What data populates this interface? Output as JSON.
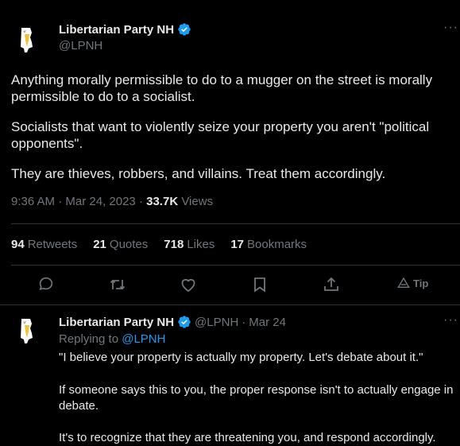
{
  "colors": {
    "background": "#000000",
    "text": "#e7e9ea",
    "muted": "#71767b",
    "accent": "#1d9bf0",
    "border": "#2f3336"
  },
  "tweet": {
    "author_name": "Libertarian Party NH",
    "handle": "@LPNH",
    "paragraphs": [
      "Anything morally permissible to do to a mugger on the street is morally permissible to do to a socialist.",
      "Socialists that want to violently seize your property you aren't \"political opponents\".",
      "They are thieves, robbers, and villains. Treat them accordingly."
    ],
    "time": "9:36 AM",
    "date": "Mar 24, 2023",
    "views_count": "33.7K",
    "views_label": "Views",
    "stats": {
      "retweets_count": "94",
      "retweets_label": "Retweets",
      "quotes_count": "21",
      "quotes_label": "Quotes",
      "likes_count": "718",
      "likes_label": "Likes",
      "bookmarks_count": "17",
      "bookmarks_label": "Bookmarks"
    },
    "tip_label": "Tip"
  },
  "reply": {
    "author_name": "Libertarian Party NH",
    "handle": "@LPNH",
    "date": "Mar 24",
    "replying_label": "Replying to",
    "replying_handle": "@LPNH",
    "paragraphs": [
      "\"I believe your property is actually my property. Let's debate about it.\"",
      "If someone says this to you, the proper response isn't to actually engage in debate.",
      "It's to recognize that they are threatening you, and respond accordingly."
    ]
  }
}
